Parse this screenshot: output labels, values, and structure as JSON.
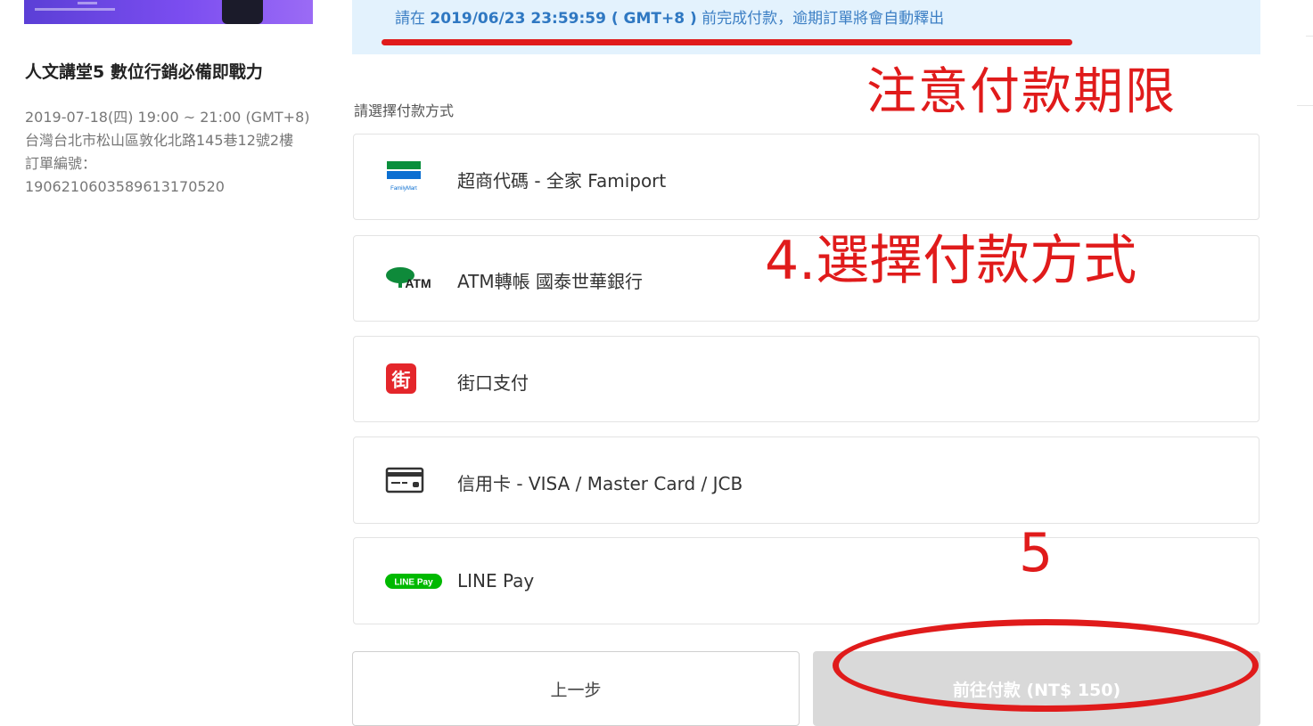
{
  "event": {
    "title": "人文講堂5 數位行銷必備即戰力",
    "datetime": "2019-07-18(四) 19:00 ~ 21:00 (GMT+8)",
    "address": "台灣台北市松山區敦化北路145巷12號2樓",
    "order_label": "訂單編號：",
    "order_number": "19062106035896131705 20"
  },
  "notice": {
    "prefix": "請在 ",
    "deadline": "2019/06/23 23:59:59 ( GMT+8 )",
    "suffix": " 前完成付款，逾期訂單將會自動釋出"
  },
  "payment": {
    "section_label": "請選擇付款方式",
    "options": [
      {
        "label": "超商代碼 - 全家 Famiport",
        "icon": "familymart-icon"
      },
      {
        "label": "ATM轉帳 國泰世華銀行",
        "icon": "atm-cathay-icon"
      },
      {
        "label": "街口支付",
        "icon": "jkopay-icon"
      },
      {
        "label": "信用卡 - VISA / Master Card / JCB",
        "icon": "credit-card-icon"
      },
      {
        "label": "LINE Pay",
        "icon": "linepay-icon"
      }
    ]
  },
  "icons": {
    "jkopay_char": "街",
    "familymart_text": "FamilyMart",
    "atm_text": "ATM",
    "linepay_text": "LINE Pay"
  },
  "buttons": {
    "back": "上一步",
    "pay": "前往付款 (NT$ 150)"
  },
  "annotations": {
    "deadline_note": "注意付款期限",
    "step4": "4.選擇付款方式",
    "step5": "5"
  },
  "colors": {
    "notice_bg": "#e3f2fd",
    "notice_text": "#3c7fc4",
    "annotation_red": "#e01b1b",
    "pay_button_disabled": "#d9d9d9"
  }
}
